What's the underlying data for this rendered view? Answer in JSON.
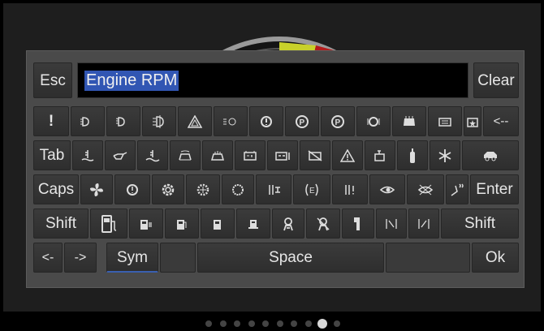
{
  "input": {
    "value": "Engine RPM",
    "esc_label": "Esc",
    "clear_label": "Clear"
  },
  "row1": {
    "exclaim_label": "!",
    "backspace_label": "<--",
    "icons": [
      "headlight-low-icon",
      "headlight-icon",
      "fog-light-icon",
      "hazard-warning-icon",
      "parking-lights-icon",
      "brake-warning-icon",
      "parking-brake-icon",
      "parking-brake-circle-icon",
      "tire-pressure-icon",
      "windshield-icon",
      "rear-window-icon",
      "fuel-cap-icon"
    ]
  },
  "row2": {
    "tab_label": "Tab",
    "icons": [
      "coolant-temp-icon",
      "oil-pressure-icon",
      "coolant-level-icon",
      "washer-fluid-icon",
      "heater-icon",
      "battery-icon",
      "battery-charge-icon",
      "battery-fault-icon",
      "warning-triangle-icon",
      "engine-check-icon",
      "fuel-filter-icon",
      "snowflake-icon",
      "car-side-icon"
    ]
  },
  "row3": {
    "caps_label": "Caps",
    "enter_label": "Enter",
    "icons": [
      "fan-icon",
      "brake-disc-icon",
      "gear-wheel-icon",
      "cog-icon",
      "circle-gear-icon",
      "fuse-icon",
      "gas-circle-icon",
      "fuse-alt-icon",
      "eye-icon",
      "no-eye-icon",
      "seat-heater-icon"
    ]
  },
  "row4": {
    "shift_left_label": "Shift",
    "shift_right_label": "Shift",
    "icons": [
      "fuel-pump-icon",
      "fuel-gauge-icon",
      "fuel-station-icon",
      "fuel-pump-small-icon",
      "fuel-can-icon",
      "driver-assist-icon",
      "driver-assist-off-icon",
      "door-icon",
      "lane-left-icon",
      "lane-right-icon"
    ]
  },
  "row5": {
    "left_label": "<-",
    "right_label": "->",
    "sym_label": "Sym",
    "space_label": "Space",
    "ok_label": "Ok"
  },
  "pager": {
    "count": 10,
    "active": 8
  },
  "colors": {
    "selection": "#3156b3",
    "sym_underline": "#3a5fb0",
    "gauge_yellow": "#c8d12a",
    "gauge_red": "#b51b1b"
  }
}
